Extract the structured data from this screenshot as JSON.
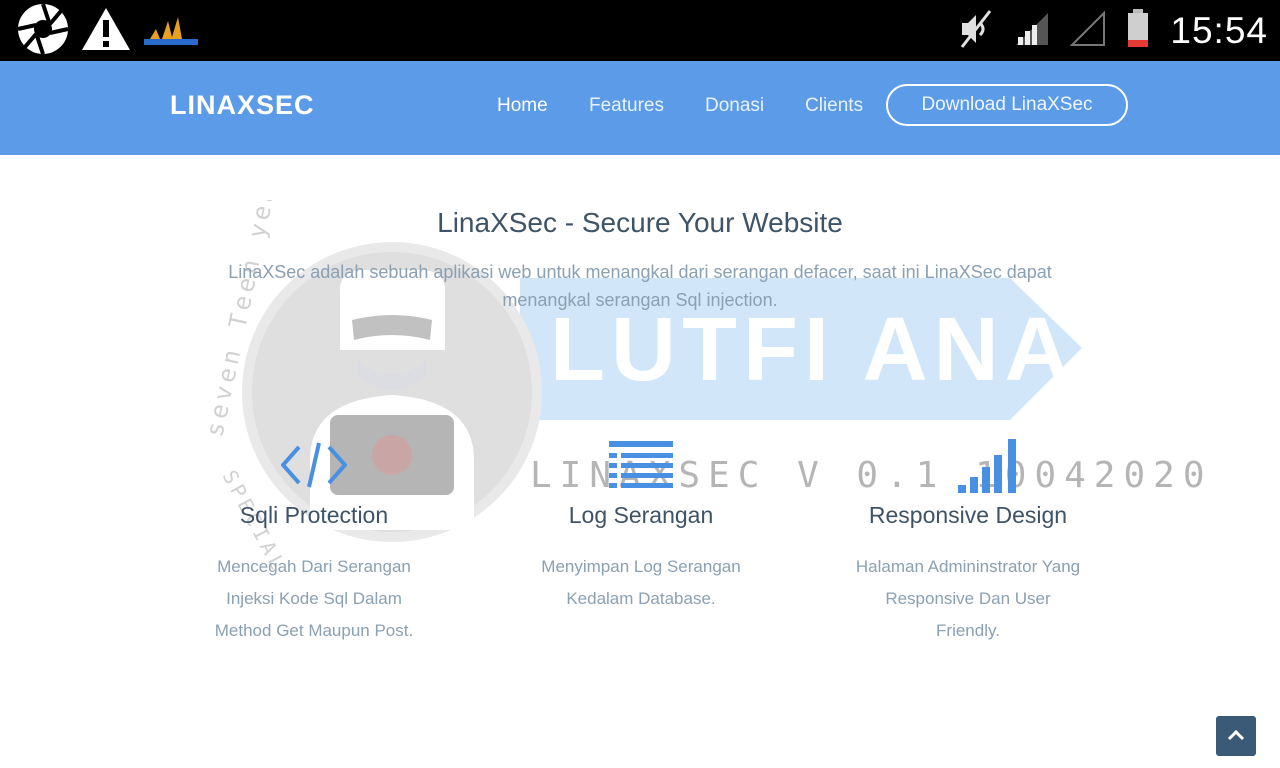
{
  "status_bar": {
    "time": "15:54",
    "icons": [
      "aperture-icon",
      "warning-icon",
      "app-logo-icon",
      "mute-icon",
      "signal-icon",
      "signal-empty-icon",
      "battery-low-icon"
    ]
  },
  "navbar": {
    "brand": "LINAXSEC",
    "links": [
      {
        "label": "Home",
        "active": true
      },
      {
        "label": "Features",
        "active": false
      },
      {
        "label": "Donasi",
        "active": false
      },
      {
        "label": "Clients",
        "active": false
      }
    ],
    "cta": "Download LinaXSec",
    "bg_color": "#5b9be8"
  },
  "hero": {
    "title": "LinaXSec - Secure Your Website",
    "subtitle": "LinaXSec adalah sebuah aplikasi web untuk menangkal dari serangan defacer, saat ini LinaXSec dapat menangkal serangan Sql injection."
  },
  "watermark": {
    "ring_text": "seven Teen years OLD",
    "bottom_text": "SPECIAL TEAM",
    "banner_text": "LUTFI ANAM",
    "version_text": "LINAXSEC V 0.1 10042020"
  },
  "features": [
    {
      "icon": "code-icon",
      "title": "Sqli Protection",
      "desc": "Mencegah Dari Serangan Injeksi Kode Sql Dalam Method Get Maupun Post."
    },
    {
      "icon": "list-icon",
      "title": "Log Serangan",
      "desc": "Menyimpan Log Serangan Kedalam Database."
    },
    {
      "icon": "bar-chart-icon",
      "title": "Responsive Design",
      "desc": "Halaman Admininstrator Yang Responsive Dan User Friendly."
    }
  ],
  "accent_color": "#4a90e2",
  "back_to_top_icon": "chevron-up-icon"
}
